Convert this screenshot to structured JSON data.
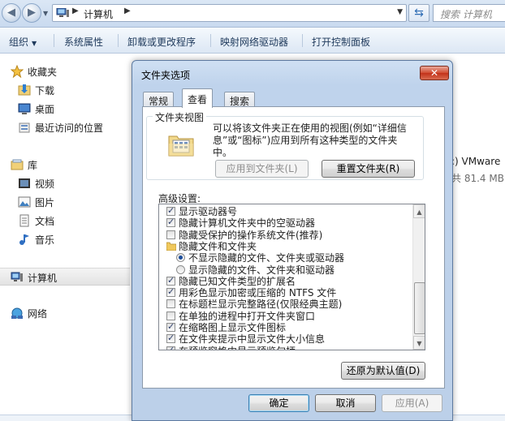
{
  "explorer": {
    "address_location": "计算机",
    "search_placeholder": "搜索 计算机",
    "toolbar": {
      "organize": "组织",
      "system_properties": "系统属性",
      "uninstall": "卸载或更改程序",
      "map_drive": "映射网络驱动器",
      "control_panel": "打开控制面板"
    },
    "sidebar": {
      "favorites": "收藏夹",
      "downloads": "下载",
      "desktop": "桌面",
      "recent": "最近访问的位置",
      "libraries": "库",
      "videos": "视频",
      "pictures": "图片",
      "documents": "文档",
      "music": "音乐",
      "computer": "计算机",
      "network": "网络"
    },
    "drive": {
      "name_fragment": ":) VMware",
      "size_fragment": "共 81.4 MB"
    }
  },
  "dialog": {
    "title": "文件夹选项",
    "close_glyph": "✕",
    "tabs": [
      "常规",
      "查看",
      "搜索"
    ],
    "active_tab": 1,
    "folder_view": {
      "legend": "文件夹视图",
      "description": "可以将该文件夹正在使用的视图(例如“详细信息”或“图标”)应用到所有这种类型的文件夹中。",
      "apply_button": "应用到文件夹(L)",
      "reset_button": "重置文件夹(R)"
    },
    "advanced_label": "高级设置:",
    "advanced_items": [
      {
        "type": "checkbox",
        "checked": true,
        "label": "显示驱动器号",
        "indent": 0
      },
      {
        "type": "checkbox",
        "checked": true,
        "label": "隐藏计算机文件夹中的空驱动器",
        "indent": 0
      },
      {
        "type": "checkbox",
        "checked": false,
        "label": "隐藏受保护的操作系统文件(推荐)",
        "indent": 0
      },
      {
        "type": "folder",
        "checked": false,
        "label": "隐藏文件和文件夹",
        "indent": 0
      },
      {
        "type": "radio",
        "checked": true,
        "label": "不显示隐藏的文件、文件夹或驱动器",
        "indent": 1
      },
      {
        "type": "radio",
        "checked": false,
        "label": "显示隐藏的文件、文件夹和驱动器",
        "indent": 1
      },
      {
        "type": "checkbox",
        "checked": true,
        "label": "隐藏已知文件类型的扩展名",
        "indent": 0
      },
      {
        "type": "checkbox",
        "checked": true,
        "label": "用彩色显示加密或压缩的 NTFS 文件",
        "indent": 0
      },
      {
        "type": "checkbox",
        "checked": false,
        "label": "在标题栏显示完整路径(仅限经典主题)",
        "indent": 0
      },
      {
        "type": "checkbox",
        "checked": false,
        "label": "在单独的进程中打开文件夹窗口",
        "indent": 0
      },
      {
        "type": "checkbox",
        "checked": true,
        "label": "在缩略图上显示文件图标",
        "indent": 0
      },
      {
        "type": "checkbox",
        "checked": true,
        "label": "在文件夹提示中显示文件大小信息",
        "indent": 0
      },
      {
        "type": "checkbox",
        "checked": true,
        "label": "在预览窗格中显示预览句柄",
        "indent": 0
      }
    ],
    "restore_defaults": "还原为默认值(D)",
    "ok": "确定",
    "cancel": "取消",
    "apply": "应用(A)"
  },
  "colors": {
    "titlebar": "#dbe7f5",
    "dialog_frame": "#bfd3ec",
    "close_button": "#c2311a",
    "link_blue": "#1e395b"
  }
}
